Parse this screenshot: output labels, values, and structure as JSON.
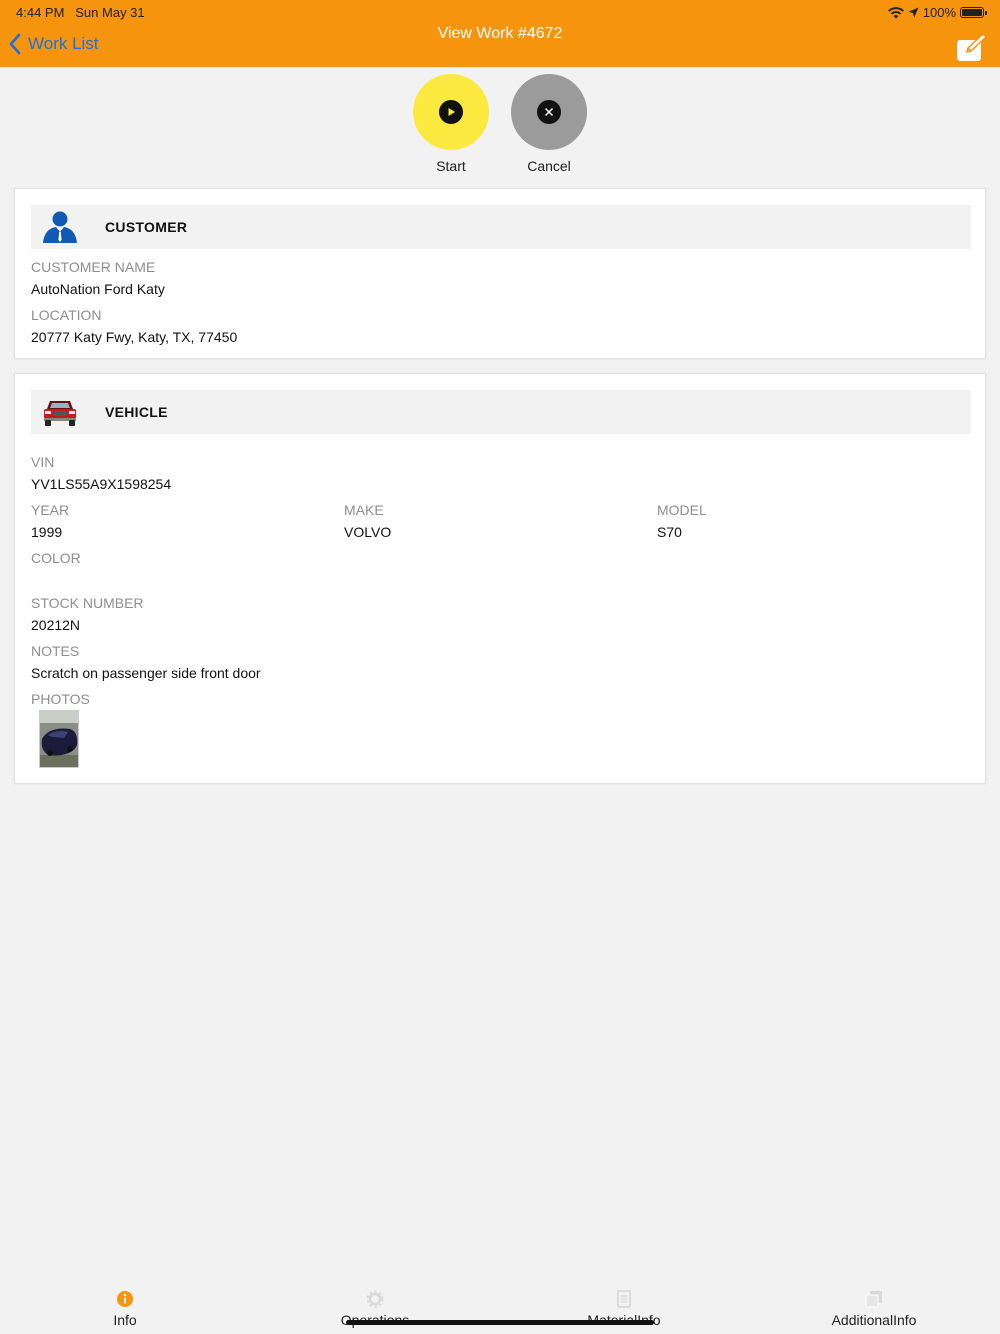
{
  "status_bar": {
    "time": "4:44 PM",
    "date": "Sun May 31",
    "battery": "100%"
  },
  "header": {
    "back_label": "Work List",
    "title": "View Work #4672",
    "edit_icon": "edit-icon",
    "color": "#f7940d"
  },
  "actions": {
    "start_label": "Start",
    "cancel_label": "Cancel",
    "start_color": "#fbe940",
    "cancel_color": "#9b9b9b"
  },
  "customer": {
    "title": "CUSTOMER",
    "icon": "person-icon",
    "name_label": "CUSTOMER NAME",
    "name_value": "AutoNation Ford Katy",
    "location_label": "LOCATION",
    "location_value": "20777 Katy Fwy, Katy, TX, 77450"
  },
  "vehicle": {
    "title": "VEHICLE",
    "icon": "truck-icon",
    "vin_label": "VIN",
    "vin_value": "YV1LS55A9X1598254",
    "year_label": "YEAR",
    "year_value": "1999",
    "make_label": "MAKE",
    "make_value": "VOLVO",
    "model_label": "MODEL",
    "model_value": "S70",
    "color_label": "COLOR",
    "color_value": "",
    "stock_label": "STOCK NUMBER",
    "stock_value": "20212N",
    "notes_label": "NOTES",
    "notes_value": "Scratch on passenger side front door",
    "photos_label": "PHOTOS"
  },
  "tabs": [
    {
      "label": "Info",
      "icon": "info-icon",
      "active": true
    },
    {
      "label": "Operations",
      "icon": "gear-icon",
      "active": false
    },
    {
      "label": "MaterialInfo",
      "icon": "list-icon",
      "active": false
    },
    {
      "label": "AdditionalInfo",
      "icon": "copy-icon",
      "active": false
    }
  ]
}
